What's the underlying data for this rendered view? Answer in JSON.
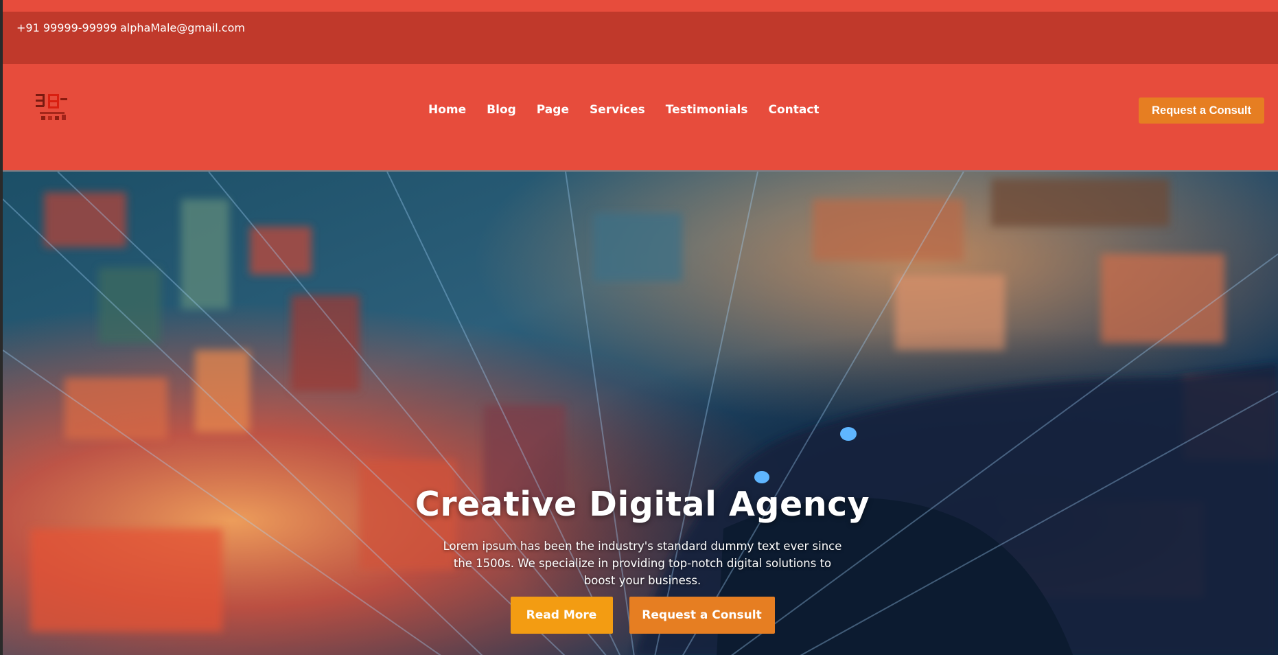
{
  "topbar": {
    "phone": "+91 99999-99999",
    "email": "alphaMale@gmail.com"
  },
  "navbar": {
    "logo_icon": "pixel-logo-icon",
    "links": [
      "Home",
      "Blog",
      "Page",
      "Services",
      "Testimonials",
      "Contact"
    ],
    "cta_label": "Request a Consult"
  },
  "hero": {
    "title": "Creative Digital Agency",
    "text": "Lorem ipsum has been the industry's standard dummy text ever since the 1500s. We specialize in providing top-notch digital solutions to boost your business.",
    "read_more_label": "Read More",
    "consult_label": "Request a Consult"
  },
  "colors": {
    "primary": "#e74c3c",
    "topbar": "#c0392b",
    "button_orange": "#e67e22",
    "button_yellow": "#f39c12"
  }
}
